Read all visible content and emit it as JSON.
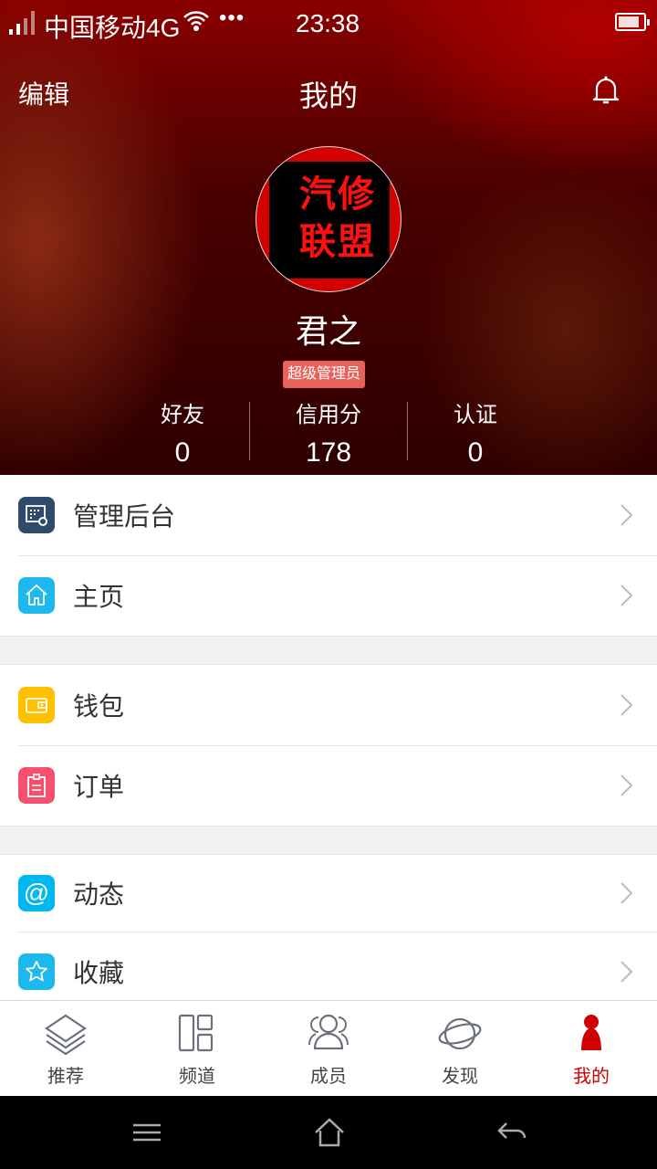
{
  "status_bar": {
    "carrier": "中国移动4G",
    "time": "23:38",
    "battery_percent": 75
  },
  "header": {
    "edit_label": "编辑",
    "title": "我的"
  },
  "profile": {
    "avatar_text": [
      "汽修",
      "联盟"
    ],
    "name": "君之",
    "role_badge": "超级管理员",
    "stats": [
      {
        "label": "好友",
        "value": "0"
      },
      {
        "label": "信用分",
        "value": "178"
      },
      {
        "label": "认证",
        "value": "0"
      }
    ]
  },
  "menu_groups": [
    [
      {
        "label": "管理后台",
        "icon": "admin-dashboard-icon",
        "color": "#2f4a6b"
      },
      {
        "label": "主页",
        "icon": "home-icon",
        "color": "#1eb8ef"
      }
    ],
    [
      {
        "label": "钱包",
        "icon": "wallet-icon",
        "color": "#ffc000"
      },
      {
        "label": "订单",
        "icon": "clipboard-icon",
        "color": "#f5506e"
      }
    ],
    [
      {
        "label": "动态",
        "icon": "at-icon",
        "color": "#00b8f0"
      },
      {
        "label": "收藏",
        "icon": "star-icon",
        "color": "#1eb8ef"
      }
    ]
  ],
  "tabbar": {
    "items": [
      {
        "label": "推荐",
        "icon": "layers-icon"
      },
      {
        "label": "频道",
        "icon": "panels-icon"
      },
      {
        "label": "成员",
        "icon": "members-icon"
      },
      {
        "label": "发现",
        "icon": "planet-icon"
      },
      {
        "label": "我的",
        "icon": "person-icon",
        "active": true
      }
    ],
    "active_color": "#d10000"
  }
}
